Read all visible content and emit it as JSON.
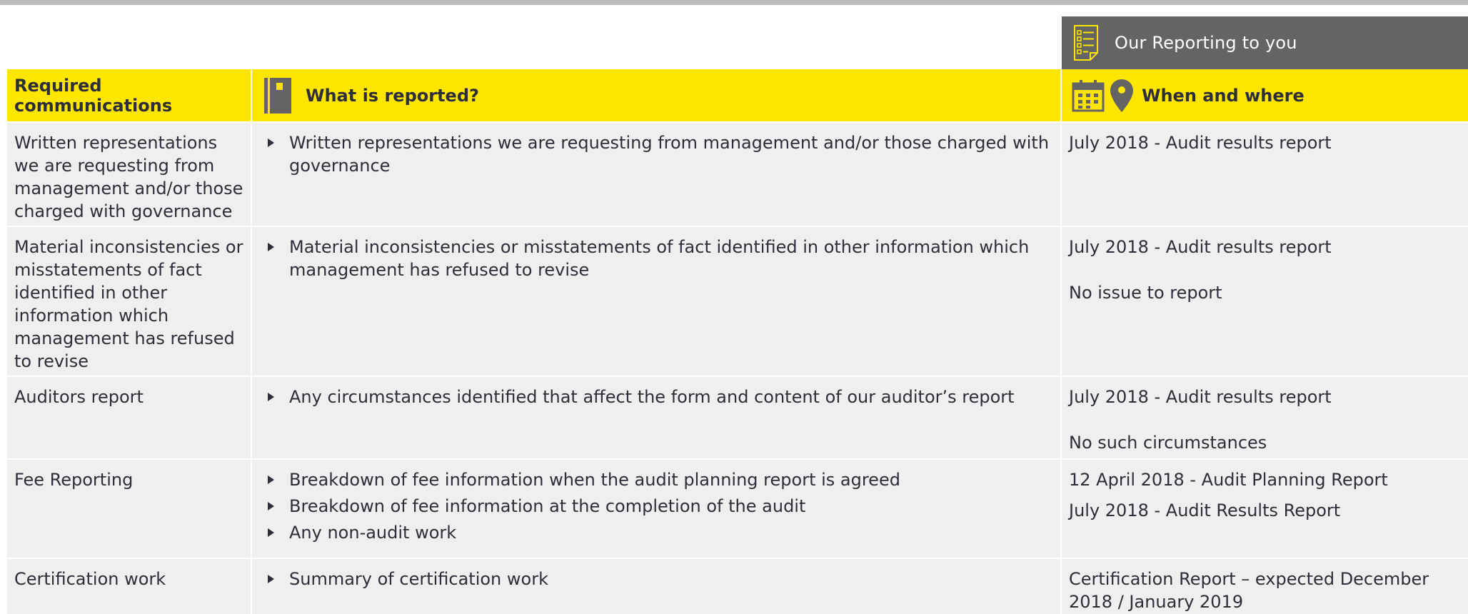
{
  "banner": {
    "title": "Our Reporting to you",
    "icon": "checklist-icon"
  },
  "headers": {
    "required": "Required communications",
    "what": "What is reported?",
    "when": "When and where",
    "what_icon": "notebook-icon",
    "when_icons": [
      "calendar-icon",
      "location-pin-icon"
    ]
  },
  "colors": {
    "accent": "#ffe600",
    "banner": "#646464",
    "cell": "#efefef",
    "text": "#2e2e38"
  },
  "rows": [
    {
      "name": "Written representations we are requesting from management and/or those charged with governance",
      "items": [
        "Written representations we are requesting from management and/or those charged with governance"
      ],
      "when": [
        "July 2018 - Audit results report"
      ]
    },
    {
      "name": "Material inconsistencies or misstatements of fact identified in other information which management has refused to revise",
      "items": [
        "Material inconsistencies or misstatements of fact identified in other information which management has refused to revise"
      ],
      "when": [
        "July 2018 - Audit results report",
        "No issue to report"
      ]
    },
    {
      "name": "Auditors report",
      "items": [
        "Any circumstances identified that affect the form and content of our auditor’s report"
      ],
      "when": [
        "July 2018 - Audit results report",
        "No such circumstances"
      ]
    },
    {
      "name": "Fee Reporting",
      "items": [
        "Breakdown of fee information when the  audit planning report is agreed",
        "Breakdown of fee information at the completion of the audit",
        "Any non-audit work"
      ],
      "when": [
        "12 April 2018 - Audit Planning Report",
        "July 2018 - Audit Results Report"
      ]
    },
    {
      "name": "Certification work",
      "items": [
        "Summary of certification work"
      ],
      "when": [
        "Certification Report – expected December 2018 / January 2019"
      ]
    }
  ]
}
